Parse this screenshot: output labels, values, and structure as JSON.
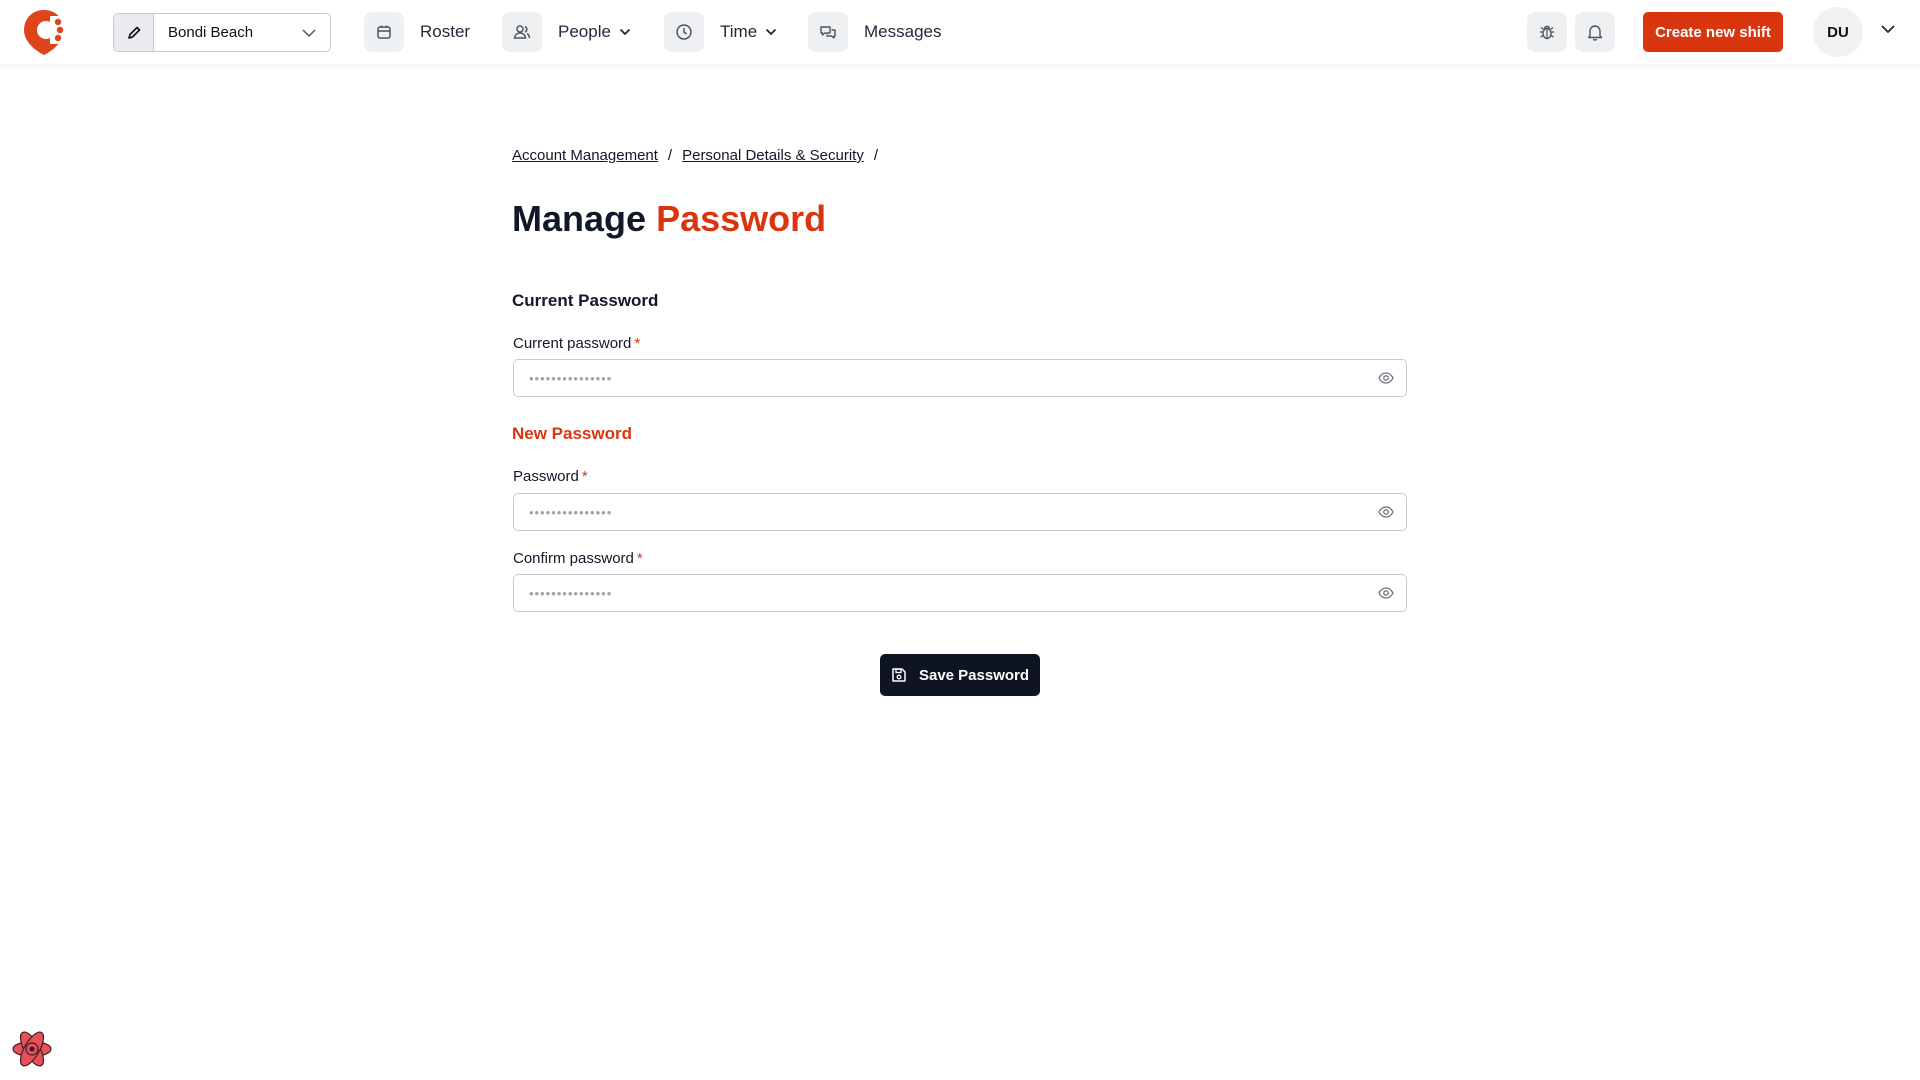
{
  "colors": {
    "accent": "#d9360f",
    "dark_button": "#0e1422"
  },
  "header": {
    "location": "Bondi Beach",
    "nav": [
      {
        "label": "Roster",
        "icon": "calendar-icon"
      },
      {
        "label": "People",
        "icon": "people-icon"
      },
      {
        "label": "Time",
        "icon": "clock-icon"
      },
      {
        "label": "Messages",
        "icon": "chat-icon"
      }
    ],
    "create_label": "Create new shift",
    "avatar_initials": "DU"
  },
  "breadcrumb": {
    "items": [
      "Account Management",
      "Personal Details & Security"
    ],
    "separator": "/"
  },
  "title": {
    "main": "Manage",
    "accent": "Password"
  },
  "current_section": {
    "heading": "Current Password",
    "label": "Current password",
    "required": "*",
    "placeholder": "•••••••••••••••"
  },
  "new_section": {
    "heading": "New Password",
    "password_label": "Password",
    "confirm_label": "Confirm password",
    "required": "*",
    "placeholder": "•••••••••••••••"
  },
  "save_label": "Save Password"
}
